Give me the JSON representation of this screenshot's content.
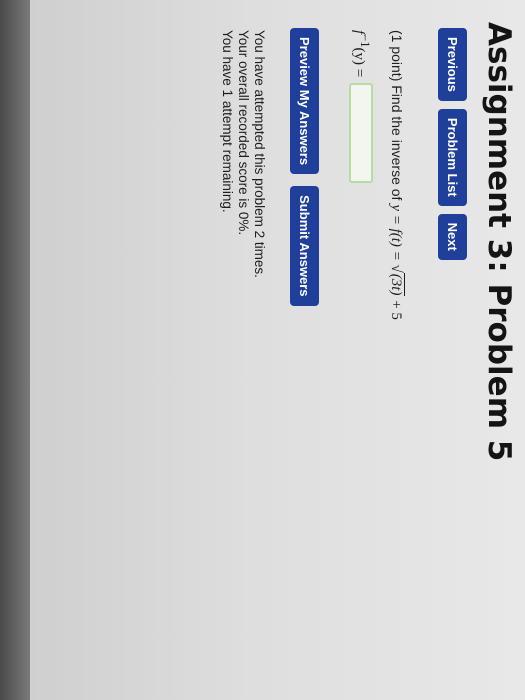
{
  "title": "Assignment 3: Problem 5",
  "nav": {
    "previous": "Previous",
    "problem_list": "Problem List",
    "next": "Next"
  },
  "question": {
    "prefix": "(1 point) Find the inverse of",
    "equation_lhs": "y = f(t) =",
    "sqrt_radical": "√",
    "sqrt_arg": "(3t)",
    "equation_rest": "+ 5"
  },
  "answer": {
    "label": "f",
    "label_sup": "−1",
    "label_rest": "(y) =",
    "value": "",
    "placeholder": ""
  },
  "actions": {
    "preview": "Preview My Answers",
    "submit": "Submit Answers"
  },
  "status": {
    "attempts": "You have attempted this problem 2 times.",
    "score": "Your overall recorded score is 0%.",
    "remaining": "You have 1 attempt remaining."
  },
  "colors": {
    "button_bg": "#1f3f9a",
    "input_border": "#b6dca0"
  }
}
